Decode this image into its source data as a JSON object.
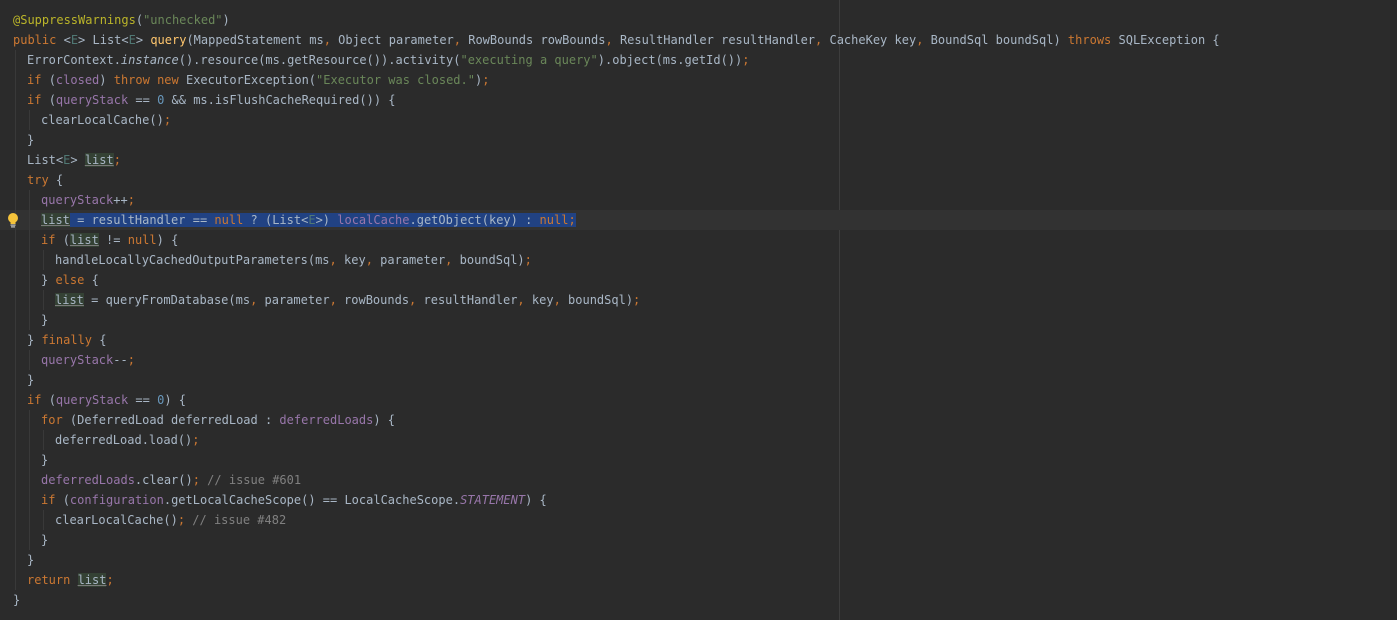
{
  "editor": {
    "language": "java",
    "current_line": 11,
    "selected_line": 11,
    "intention_bulb_line": 11,
    "lines": [
      {
        "indent": 0,
        "tokens": [
          {
            "t": "@SuppressWarnings",
            "c": "ann"
          },
          {
            "t": "(",
            "c": ""
          },
          {
            "t": "\"unchecked\"",
            "c": "str"
          },
          {
            "t": ")",
            "c": ""
          }
        ]
      },
      {
        "indent": 0,
        "tokens": [
          {
            "t": "public ",
            "c": "kw"
          },
          {
            "t": "<",
            "c": ""
          },
          {
            "t": "E",
            "c": "tp"
          },
          {
            "t": "> List<",
            "c": ""
          },
          {
            "t": "E",
            "c": "tp"
          },
          {
            "t": "> ",
            "c": ""
          },
          {
            "t": "query",
            "c": "mth"
          },
          {
            "t": "(MappedStatement ms",
            "c": ""
          },
          {
            "t": ", ",
            "c": "kw"
          },
          {
            "t": "Object parameter",
            "c": ""
          },
          {
            "t": ", ",
            "c": "kw"
          },
          {
            "t": "RowBounds rowBounds",
            "c": ""
          },
          {
            "t": ", ",
            "c": "kw"
          },
          {
            "t": "ResultHandler resultHandler",
            "c": ""
          },
          {
            "t": ", ",
            "c": "kw"
          },
          {
            "t": "CacheKey key",
            "c": ""
          },
          {
            "t": ", ",
            "c": "kw"
          },
          {
            "t": "BoundSql boundSql) ",
            "c": ""
          },
          {
            "t": "throws ",
            "c": "kw"
          },
          {
            "t": "SQLException {",
            "c": ""
          }
        ]
      },
      {
        "indent": 1,
        "tokens": [
          {
            "t": "ErrorContext.",
            "c": ""
          },
          {
            "t": "instance",
            "c": "ital"
          },
          {
            "t": "().resource(ms.getResource()).activity(",
            "c": ""
          },
          {
            "t": "\"executing a query\"",
            "c": "str"
          },
          {
            "t": ").object(ms.getId())",
            "c": ""
          },
          {
            "t": ";",
            "c": "kw"
          }
        ]
      },
      {
        "indent": 1,
        "tokens": [
          {
            "t": "if ",
            "c": "kw"
          },
          {
            "t": "(",
            "c": ""
          },
          {
            "t": "closed",
            "c": "fld"
          },
          {
            "t": ") ",
            "c": ""
          },
          {
            "t": "throw new ",
            "c": "kw"
          },
          {
            "t": "ExecutorException(",
            "c": ""
          },
          {
            "t": "\"Executor was closed.\"",
            "c": "str"
          },
          {
            "t": ")",
            "c": ""
          },
          {
            "t": ";",
            "c": "kw"
          }
        ]
      },
      {
        "indent": 1,
        "tokens": [
          {
            "t": "if ",
            "c": "kw"
          },
          {
            "t": "(",
            "c": ""
          },
          {
            "t": "queryStack",
            "c": "fld"
          },
          {
            "t": " == ",
            "c": ""
          },
          {
            "t": "0",
            "c": "num"
          },
          {
            "t": " && ms.isFlushCacheRequired()) {",
            "c": ""
          }
        ]
      },
      {
        "indent": 2,
        "tokens": [
          {
            "t": "clearLocalCache()",
            "c": ""
          },
          {
            "t": ";",
            "c": "kw"
          }
        ]
      },
      {
        "indent": 1,
        "tokens": [
          {
            "t": "}",
            "c": ""
          }
        ]
      },
      {
        "indent": 1,
        "tokens": [
          {
            "t": "List<",
            "c": ""
          },
          {
            "t": "E",
            "c": "tp"
          },
          {
            "t": "> ",
            "c": ""
          },
          {
            "t": "list",
            "c": "lv"
          },
          {
            "t": ";",
            "c": "kw"
          }
        ]
      },
      {
        "indent": 1,
        "tokens": [
          {
            "t": "try ",
            "c": "kw"
          },
          {
            "t": "{",
            "c": ""
          }
        ]
      },
      {
        "indent": 2,
        "tokens": [
          {
            "t": "queryStack",
            "c": "fld"
          },
          {
            "t": "++",
            "c": ""
          },
          {
            "t": ";",
            "c": "kw"
          }
        ]
      },
      {
        "indent": 2,
        "tokens": [
          {
            "t": "list",
            "c": "lv sel"
          },
          {
            "t": " = resultHandler == ",
            "c": "sel"
          },
          {
            "t": "null ",
            "c": "kw sel"
          },
          {
            "t": "? (List<",
            "c": "sel"
          },
          {
            "t": "E",
            "c": "tp sel"
          },
          {
            "t": ">) ",
            "c": "sel"
          },
          {
            "t": "localCache",
            "c": "fld sel"
          },
          {
            "t": ".getObject(key) : ",
            "c": "sel"
          },
          {
            "t": "null",
            "c": "kw sel"
          },
          {
            "t": ";",
            "c": "kw sel"
          }
        ]
      },
      {
        "indent": 2,
        "tokens": [
          {
            "t": "if ",
            "c": "kw"
          },
          {
            "t": "(",
            "c": ""
          },
          {
            "t": "list",
            "c": "lv"
          },
          {
            "t": " != ",
            "c": ""
          },
          {
            "t": "null",
            "c": "kw"
          },
          {
            "t": ") {",
            "c": ""
          }
        ]
      },
      {
        "indent": 3,
        "tokens": [
          {
            "t": "handleLocallyCachedOutputParameters(ms",
            "c": ""
          },
          {
            "t": ", ",
            "c": "kw"
          },
          {
            "t": "key",
            "c": ""
          },
          {
            "t": ", ",
            "c": "kw"
          },
          {
            "t": "parameter",
            "c": ""
          },
          {
            "t": ", ",
            "c": "kw"
          },
          {
            "t": "boundSql)",
            "c": ""
          },
          {
            "t": ";",
            "c": "kw"
          }
        ]
      },
      {
        "indent": 2,
        "tokens": [
          {
            "t": "} ",
            "c": ""
          },
          {
            "t": "else ",
            "c": "kw"
          },
          {
            "t": "{",
            "c": ""
          }
        ]
      },
      {
        "indent": 3,
        "tokens": [
          {
            "t": "list",
            "c": "lv"
          },
          {
            "t": " = queryFromDatabase(ms",
            "c": ""
          },
          {
            "t": ", ",
            "c": "kw"
          },
          {
            "t": "parameter",
            "c": ""
          },
          {
            "t": ", ",
            "c": "kw"
          },
          {
            "t": "rowBounds",
            "c": ""
          },
          {
            "t": ", ",
            "c": "kw"
          },
          {
            "t": "resultHandler",
            "c": ""
          },
          {
            "t": ", ",
            "c": "kw"
          },
          {
            "t": "key",
            "c": ""
          },
          {
            "t": ", ",
            "c": "kw"
          },
          {
            "t": "boundSql)",
            "c": ""
          },
          {
            "t": ";",
            "c": "kw"
          }
        ]
      },
      {
        "indent": 2,
        "tokens": [
          {
            "t": "}",
            "c": ""
          }
        ]
      },
      {
        "indent": 1,
        "tokens": [
          {
            "t": "} ",
            "c": ""
          },
          {
            "t": "finally ",
            "c": "kw"
          },
          {
            "t": "{",
            "c": ""
          }
        ]
      },
      {
        "indent": 2,
        "tokens": [
          {
            "t": "queryStack",
            "c": "fld"
          },
          {
            "t": "--",
            "c": ""
          },
          {
            "t": ";",
            "c": "kw"
          }
        ]
      },
      {
        "indent": 1,
        "tokens": [
          {
            "t": "}",
            "c": ""
          }
        ]
      },
      {
        "indent": 1,
        "tokens": [
          {
            "t": "if ",
            "c": "kw"
          },
          {
            "t": "(",
            "c": ""
          },
          {
            "t": "queryStack",
            "c": "fld"
          },
          {
            "t": " == ",
            "c": ""
          },
          {
            "t": "0",
            "c": "num"
          },
          {
            "t": ") {",
            "c": ""
          }
        ]
      },
      {
        "indent": 2,
        "tokens": [
          {
            "t": "for ",
            "c": "kw"
          },
          {
            "t": "(DeferredLoad deferredLoad : ",
            "c": ""
          },
          {
            "t": "deferredLoads",
            "c": "fld"
          },
          {
            "t": ") {",
            "c": ""
          }
        ]
      },
      {
        "indent": 3,
        "tokens": [
          {
            "t": "deferredLoad.load()",
            "c": ""
          },
          {
            "t": ";",
            "c": "kw"
          }
        ]
      },
      {
        "indent": 2,
        "tokens": [
          {
            "t": "}",
            "c": ""
          }
        ]
      },
      {
        "indent": 2,
        "tokens": [
          {
            "t": "deferredLoads",
            "c": "fld"
          },
          {
            "t": ".clear()",
            "c": ""
          },
          {
            "t": "; ",
            "c": "kw"
          },
          {
            "t": "// issue #601",
            "c": "cmt"
          }
        ]
      },
      {
        "indent": 2,
        "tokens": [
          {
            "t": "if ",
            "c": "kw"
          },
          {
            "t": "(",
            "c": ""
          },
          {
            "t": "configuration",
            "c": "fld"
          },
          {
            "t": ".getLocalCacheScope() == LocalCacheScope.",
            "c": ""
          },
          {
            "t": "STATEMENT",
            "c": "statc"
          },
          {
            "t": ") {",
            "c": ""
          }
        ]
      },
      {
        "indent": 3,
        "tokens": [
          {
            "t": "clearLocalCache()",
            "c": ""
          },
          {
            "t": "; ",
            "c": "kw"
          },
          {
            "t": "// issue #482",
            "c": "cmt"
          }
        ]
      },
      {
        "indent": 2,
        "tokens": [
          {
            "t": "}",
            "c": ""
          }
        ]
      },
      {
        "indent": 1,
        "tokens": [
          {
            "t": "}",
            "c": ""
          }
        ]
      },
      {
        "indent": 1,
        "tokens": [
          {
            "t": "return ",
            "c": "kw"
          },
          {
            "t": "list",
            "c": "lv"
          },
          {
            "t": ";",
            "c": "kw"
          }
        ]
      },
      {
        "indent": 0,
        "tokens": [
          {
            "t": "}",
            "c": ""
          }
        ]
      }
    ]
  },
  "colors": {
    "background": "#2b2b2b",
    "default_text": "#a9b7c6",
    "keyword": "#cc7832",
    "annotation": "#bbb529",
    "string": "#6a8759",
    "number": "#6897bb",
    "field": "#9876aa",
    "method_declaration": "#ffc66d",
    "type_parameter": "#507874",
    "comment": "#808080",
    "selection": "#214283",
    "current_line": "#323232",
    "reassigned_variable_highlight": "#344134",
    "intention_bulb": "#f5c33b"
  },
  "icons": {
    "intention": "lightbulb-icon"
  }
}
